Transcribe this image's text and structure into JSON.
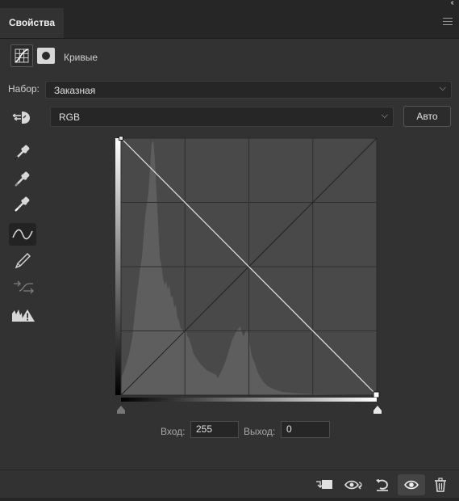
{
  "window": {
    "collapse_label": "‹‹"
  },
  "tab": {
    "label": "Свойства"
  },
  "header": {
    "title": "Кривые",
    "adjustment_icon": "curves-grid-icon",
    "mask_icon": "mask-icon"
  },
  "preset": {
    "label": "Набор:",
    "value": "Заказная"
  },
  "channel": {
    "value": "RGB"
  },
  "auto_button": {
    "label": "Авто"
  },
  "tools": [
    {
      "name": "on-image-adjust-icon"
    },
    {
      "name": "black-point-eyedropper-icon"
    },
    {
      "name": "gray-point-eyedropper-icon"
    },
    {
      "name": "white-point-eyedropper-icon"
    },
    {
      "name": "edit-curve-points-icon",
      "selected": true
    },
    {
      "name": "pencil-draw-icon"
    },
    {
      "name": "smooth-curve-icon"
    },
    {
      "name": "clipping-warning-icon"
    }
  ],
  "curve": {
    "points": [
      [
        0,
        255
      ],
      [
        255,
        0
      ]
    ],
    "grid_divisions": 4
  },
  "input": {
    "label": "Вход:",
    "value": "255"
  },
  "output": {
    "label": "Выход:",
    "value": "0"
  },
  "bottom_toolbar": [
    {
      "name": "clip-to-layer-icon"
    },
    {
      "name": "view-previous-state-icon"
    },
    {
      "name": "reset-adjustments-icon"
    },
    {
      "name": "toggle-visibility-icon",
      "active": true
    },
    {
      "name": "delete-icon"
    }
  ]
}
